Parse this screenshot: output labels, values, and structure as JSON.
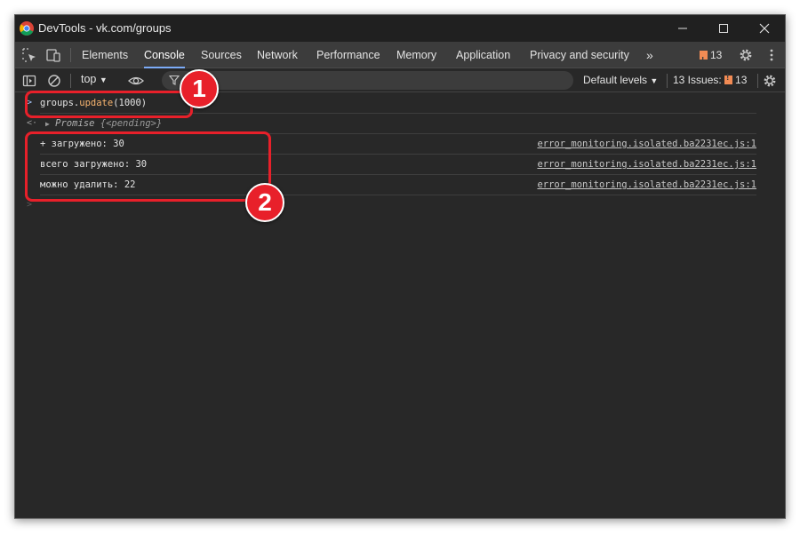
{
  "window": {
    "title": "DevTools - vk.com/groups"
  },
  "titlebar": {
    "minimize_icon": "minimize-icon",
    "maximize_icon": "maximize-icon",
    "close_icon": "close-icon"
  },
  "tabs": [
    {
      "label": "Elements"
    },
    {
      "label": "Console",
      "active": true
    },
    {
      "label": "Sources"
    },
    {
      "label": "Network"
    },
    {
      "label": "Performance"
    },
    {
      "label": "Memory"
    },
    {
      "label": "Application"
    },
    {
      "label": "Privacy and security"
    }
  ],
  "tabbar": {
    "more_tabs": "»",
    "issues_count": "13"
  },
  "console_toolbar": {
    "context": "top",
    "levels": "Default levels",
    "issues_label": "13 Issues:",
    "issues_count": "13"
  },
  "console": {
    "input_command": {
      "object": "groups.",
      "method": "update",
      "args": "(1000)"
    },
    "result": {
      "label": "Promise",
      "state": "{<pending>}"
    },
    "logs": [
      {
        "text": "+ загружено: 30",
        "source": "error_monitoring.isolated.ba2231ec.js:1"
      },
      {
        "text": "всего загружено: 30",
        "source": "error_monitoring.isolated.ba2231ec.js:1"
      },
      {
        "text": "можно удалить: 22",
        "source": "error_monitoring.isolated.ba2231ec.js:1"
      }
    ]
  },
  "annotations": {
    "callout_1": "1",
    "callout_2": "2",
    "color": "#e8202a"
  },
  "colors": {
    "background": "#282828",
    "tabbar": "#3c3c3c",
    "accent": "#7cacf8"
  }
}
